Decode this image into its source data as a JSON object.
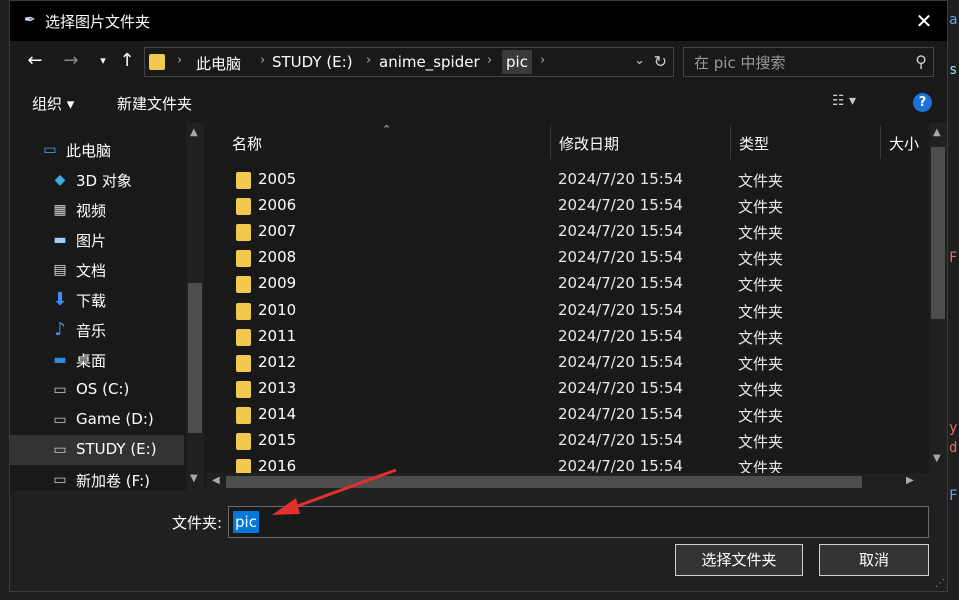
{
  "window": {
    "title": "选择图片文件夹",
    "close_icon": "close-icon"
  },
  "address": {
    "crumbs": [
      "此电脑",
      "STUDY (E:)",
      "anime_spider",
      "pic"
    ],
    "separator": "›"
  },
  "search": {
    "placeholder": "在 pic 中搜索"
  },
  "toolbar": {
    "organize": "组织 ▾",
    "new_folder": "新建文件夹",
    "help": "?"
  },
  "nav": {
    "items": [
      {
        "label": "此电脑",
        "icon": "pc-icon"
      },
      {
        "label": "3D 对象",
        "icon": "cube-icon"
      },
      {
        "label": "视频",
        "icon": "video-icon"
      },
      {
        "label": "图片",
        "icon": "picture-icon"
      },
      {
        "label": "文档",
        "icon": "document-icon"
      },
      {
        "label": "下载",
        "icon": "download-icon"
      },
      {
        "label": "音乐",
        "icon": "music-icon"
      },
      {
        "label": "桌面",
        "icon": "desktop-icon"
      },
      {
        "label": "OS (C:)",
        "icon": "drive-icon"
      },
      {
        "label": "Game (D:)",
        "icon": "drive-icon"
      },
      {
        "label": "STUDY (E:)",
        "icon": "drive-icon",
        "selected": true
      },
      {
        "label": "新加卷 (F:)",
        "icon": "drive-icon"
      }
    ]
  },
  "columns": {
    "name": "名称",
    "date": "修改日期",
    "type": "类型",
    "size": "大小"
  },
  "files": [
    {
      "name": "2005",
      "date": "2024/7/20 15:54",
      "type": "文件夹"
    },
    {
      "name": "2006",
      "date": "2024/7/20 15:54",
      "type": "文件夹"
    },
    {
      "name": "2007",
      "date": "2024/7/20 15:54",
      "type": "文件夹"
    },
    {
      "name": "2008",
      "date": "2024/7/20 15:54",
      "type": "文件夹"
    },
    {
      "name": "2009",
      "date": "2024/7/20 15:54",
      "type": "文件夹"
    },
    {
      "name": "2010",
      "date": "2024/7/20 15:54",
      "type": "文件夹"
    },
    {
      "name": "2011",
      "date": "2024/7/20 15:54",
      "type": "文件夹"
    },
    {
      "name": "2012",
      "date": "2024/7/20 15:54",
      "type": "文件夹"
    },
    {
      "name": "2013",
      "date": "2024/7/20 15:54",
      "type": "文件夹"
    },
    {
      "name": "2014",
      "date": "2024/7/20 15:54",
      "type": "文件夹"
    },
    {
      "name": "2015",
      "date": "2024/7/20 15:54",
      "type": "文件夹"
    },
    {
      "name": "2016",
      "date": "2024/7/20 15:54",
      "type": "文件夹"
    }
  ],
  "bottom": {
    "folder_label": "文件夹:",
    "folder_value": "pic",
    "select_button": "选择文件夹",
    "cancel_button": "取消"
  },
  "colors": {
    "selection": "#0078d7",
    "folder": "#f2c94c",
    "annotation_arrow": "#e03030"
  }
}
